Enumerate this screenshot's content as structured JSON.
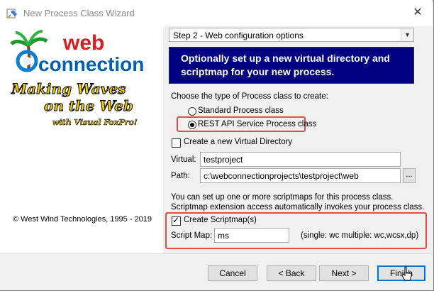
{
  "window": {
    "title": "New Process Class Wizard",
    "close_glyph": "✕"
  },
  "left_panel": {
    "logo_top": "web",
    "logo_bottom": "connection",
    "tagline_1": "Making Waves",
    "tagline_2": "on the Web",
    "tagline_3": "with Visual FoxPro!",
    "copyright": "© West Wind Technologies, 1995 - 2019"
  },
  "step_select": {
    "value": "Step 2 - Web configuration options"
  },
  "banner": {
    "line1": "Optionally set up a new virtual directory and",
    "line2": "scriptmap for your new process."
  },
  "process_type": {
    "prompt": "Choose the type of Process class to create:",
    "options": [
      {
        "label": "Standard Process class",
        "checked": false
      },
      {
        "label": "REST API Service Process class",
        "checked": true
      }
    ]
  },
  "virtual_dir": {
    "checkbox_label": "Create a new Virtual Directory",
    "checked": false,
    "virtual_label": "Virtual:",
    "virtual_value": "testproject",
    "path_label": "Path:",
    "path_value": "c:\\webconnectionprojects\\testproject\\web",
    "browse_label": "..."
  },
  "scriptmap": {
    "info_line1": "You can set up one or more scriptmaps for this process class.",
    "info_line2": "Scriptmap extension access automatically invokes your process class.",
    "checkbox_label": "Create Scriptmap(s)",
    "checked": true,
    "field_label": "Script Map:",
    "field_value": "ms",
    "hint": "(single: wc   multiple: wc,wcsx,dp)"
  },
  "buttons": {
    "cancel": "Cancel",
    "back": "< Back",
    "next": "Next >",
    "finish": "Finish"
  },
  "colors": {
    "banner_bg": "#000080",
    "highlight_red": "#e8474b",
    "logo_blue": "#0060b0",
    "logo_red": "#d42020",
    "tagline_yellow": "#f5d000"
  }
}
